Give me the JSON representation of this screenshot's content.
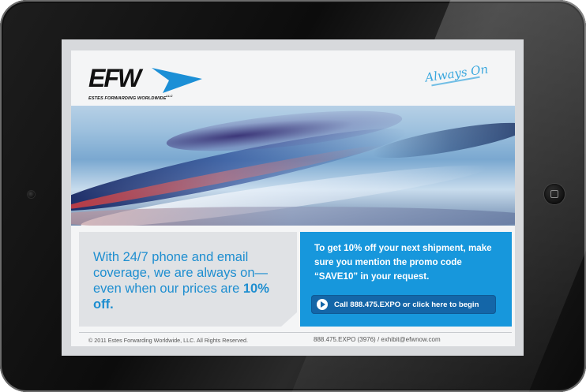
{
  "brand": {
    "logo_text": "EFW",
    "logo_subtitle": "ESTES FORWARDING WORLDWIDE",
    "logo_subtitle_sup": "LLC",
    "tagline": "Always On",
    "accent_color": "#1797dc",
    "dark_blue": "#1466a8"
  },
  "banner": {
    "icon": "motion-blur-airplane-image"
  },
  "left_promo": {
    "text_part1": "With 24/7 phone and email coverage, we are always on—even when our prices are ",
    "text_bold": "10% off."
  },
  "right_promo": {
    "text": "To get 10% off your next shipment, make sure you mention the promo code “SAVE10” in your request.",
    "cta_label": "Call 888.475.EXPO or click here to begin",
    "cta_icon": "play-arrow-icon"
  },
  "footer": {
    "copyright": "© 2011 Estes Forwarding Worldwide, LLC. All Rights Reserved.",
    "contact": "888.475.EXPO (3976) / exhibit@efwnow.com"
  }
}
